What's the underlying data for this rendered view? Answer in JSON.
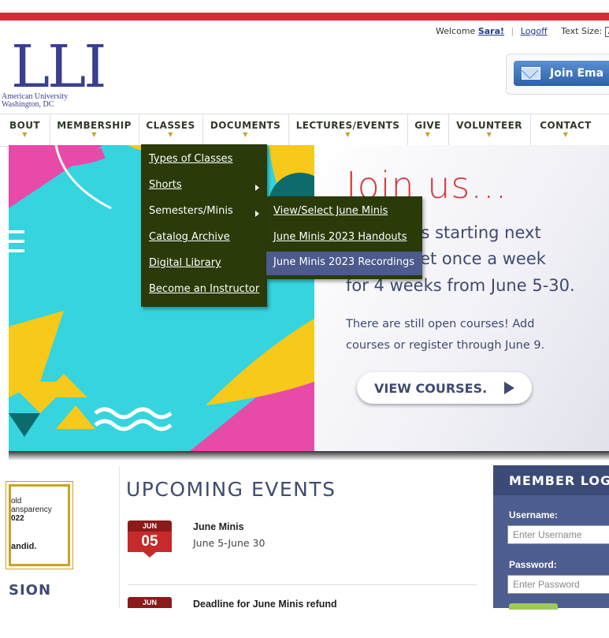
{
  "header": {
    "welcome_prefix": "Welcome",
    "user_name": "Sara!",
    "logoff_label": "Logoff",
    "text_size_label": "Text Size:",
    "text_size_value": "A",
    "logo_text": "LLI",
    "logo_subtitle_line1": "American University",
    "logo_subtitle_line2": "Washington, DC",
    "join_button_label": "Join Ema"
  },
  "nav": {
    "items": [
      {
        "label": "BOUT"
      },
      {
        "label": "MEMBERSHIP"
      },
      {
        "label": "CLASSES"
      },
      {
        "label": "DOCUMENTS"
      },
      {
        "label": "LECTURES/EVENTS"
      },
      {
        "label": "GIVE"
      },
      {
        "label": "VOLUNTEER"
      },
      {
        "label": "CONTACT"
      }
    ],
    "arrow_glyph": "▼"
  },
  "classes_menu": {
    "items": [
      {
        "label": "Types of Classes"
      },
      {
        "label": "Shorts"
      },
      {
        "label": "Semesters/Minis"
      },
      {
        "label": "Catalog Archive"
      },
      {
        "label": "Digital Library"
      },
      {
        "label": "Become an Instructor"
      }
    ],
    "submenu": [
      {
        "label": "View/Select June Minis"
      },
      {
        "label": "June Minis 2023 Handouts"
      },
      {
        "label": "June Minis 2023 Recordings"
      }
    ]
  },
  "hero": {
    "heading": "Join us...",
    "line1": "June Minis starting next",
    "line2": "Minis meet once a week",
    "line3": "for 4 weeks from June 5-30.",
    "small1": "There are still open courses! Add",
    "small2": "courses or register through June 9.",
    "button_label": "VIEW COURSES."
  },
  "sidebar": {
    "badge_line1": "old",
    "badge_line2": "ansparency",
    "badge_line3": "022",
    "badge_bottom": "andid.",
    "mission_label": "SION"
  },
  "events": {
    "title": "UPCOMING EVENTS",
    "items": [
      {
        "month": "JUN",
        "day": "05",
        "title": "June Minis",
        "date": "June 5-June 30"
      },
      {
        "month": "JUN",
        "day": "",
        "title": "Deadline for June Minis refund",
        "date": ""
      }
    ]
  },
  "login": {
    "title": "MEMBER LOGIN",
    "username_label": "Username:",
    "username_placeholder": "Enter Username",
    "password_label": "Password:",
    "password_placeholder": "Enter Password"
  },
  "colors": {
    "accent_red": "#d62c36",
    "menu_bg": "#2a3a08",
    "menu_highlight": "#4c5a8c",
    "brand_blue": "#3f4a70",
    "nav_arrow": "#c9a227"
  }
}
